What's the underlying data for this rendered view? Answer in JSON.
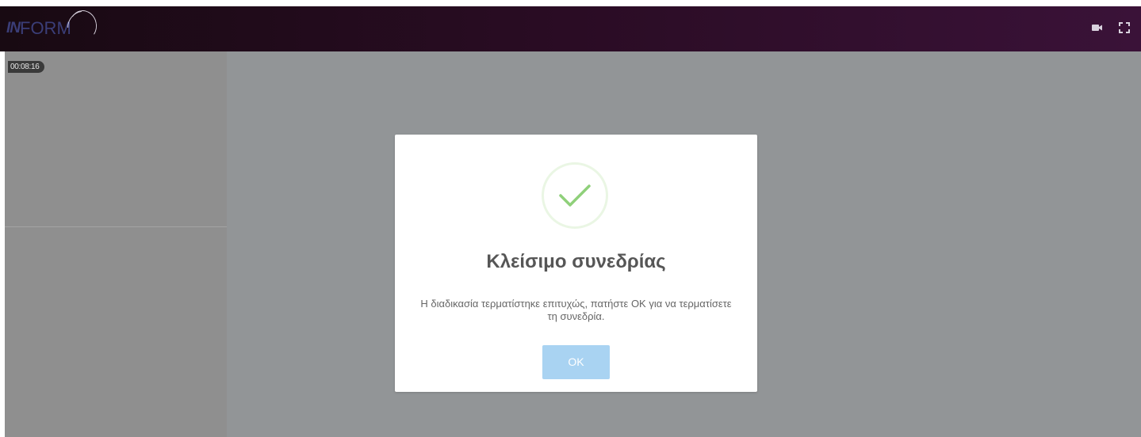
{
  "header": {
    "logo": {
      "mark": "IN",
      "text": "FORM"
    },
    "icons": [
      "video-camera-icon",
      "fullscreen-icon"
    ]
  },
  "session": {
    "timer": "00:08:16"
  },
  "dialog": {
    "icon": "check-icon",
    "title": "Κλείσιμο συνεδρίας",
    "message": "Η διαδικασία τερματίστηκε επιτυχώς, πατήστε ΟΚ για να τερματίσετε τη συνεδρία.",
    "ok_label": "OK"
  },
  "colors": {
    "header_start": "#180a12",
    "header_end": "#3a1238",
    "overlay": "#929597",
    "check_green": "#8fd07a",
    "button_blue": "#a9d3f2"
  }
}
